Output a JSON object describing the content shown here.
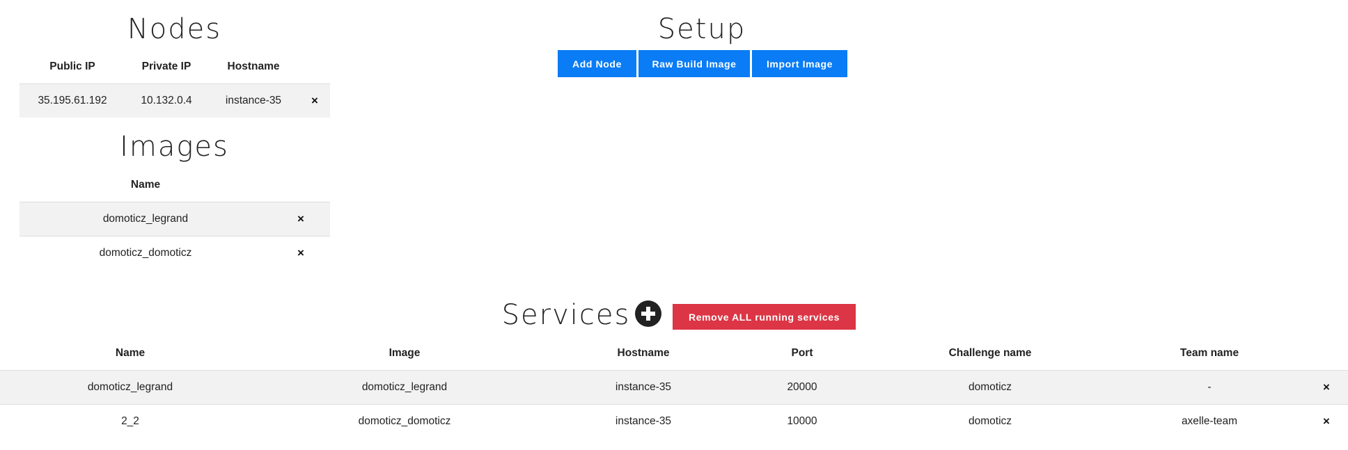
{
  "nodes": {
    "title": "Nodes",
    "columns": [
      "Public IP",
      "Private IP",
      "Hostname"
    ],
    "rows": [
      {
        "public_ip": "35.195.61.192",
        "private_ip": "10.132.0.4",
        "hostname": "instance-35",
        "remove_icon": "×"
      }
    ]
  },
  "setup": {
    "title": "Setup",
    "buttons": {
      "add_node": "Add Node",
      "raw_build_image": "Raw Build Image",
      "import_image": "Import Image"
    }
  },
  "images": {
    "title": "Images",
    "columns": [
      "Name"
    ],
    "rows": [
      {
        "name": "domoticz_legrand",
        "remove_icon": "×"
      },
      {
        "name": "domoticz_domoticz",
        "remove_icon": "×"
      }
    ]
  },
  "services": {
    "title": "Services",
    "add_icon": "plus-circle-icon",
    "remove_all_label": "Remove ALL running services",
    "columns": [
      "Name",
      "Image",
      "Hostname",
      "Port",
      "Challenge name",
      "Team name"
    ],
    "rows": [
      {
        "name": "domoticz_legrand",
        "image": "domoticz_legrand",
        "hostname": "instance-35",
        "port": "20000",
        "challenge": "domoticz",
        "team": "-",
        "remove_icon": "×"
      },
      {
        "name": "2_2",
        "image": "domoticz_domoticz",
        "hostname": "instance-35",
        "port": "10000",
        "challenge": "domoticz",
        "team": "axelle-team",
        "remove_icon": "×"
      }
    ]
  },
  "colors": {
    "primary_button": "#0a7cf5",
    "danger_button": "#dc3545",
    "row_stripe": "#f2f2f2"
  }
}
